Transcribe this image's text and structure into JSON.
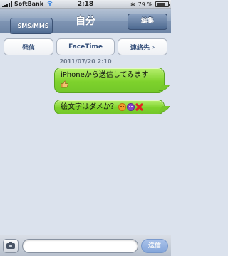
{
  "status_bar": {
    "carrier": "SoftBank",
    "time": "2:18",
    "battery_text": "79 %",
    "battery_level": 0.79
  },
  "nav": {
    "back_label": "SMS/MMS",
    "title": "自分",
    "edit_label": "編集"
  },
  "actions": {
    "call_label": "発信",
    "facetime_label": "FaceTime",
    "contact_label": "連絡先",
    "contact_chevron": "›"
  },
  "conversation": {
    "timestamp": "2011/07/20 2:10",
    "messages": [
      {
        "text": "iPhoneから送信してみます",
        "emoji": [
          "thumbs-up-icon"
        ]
      },
      {
        "text": "絵文字はダメか？",
        "emoji": [
          "angry-face-icon",
          "devil-face-icon",
          "cross-mark-icon"
        ]
      }
    ]
  },
  "compose": {
    "input_value": "",
    "send_label": "送信"
  },
  "colors": {
    "bubble_green": "#7ed22c",
    "nav_blue": "#6d84a5",
    "background": "#dbe2ed"
  }
}
